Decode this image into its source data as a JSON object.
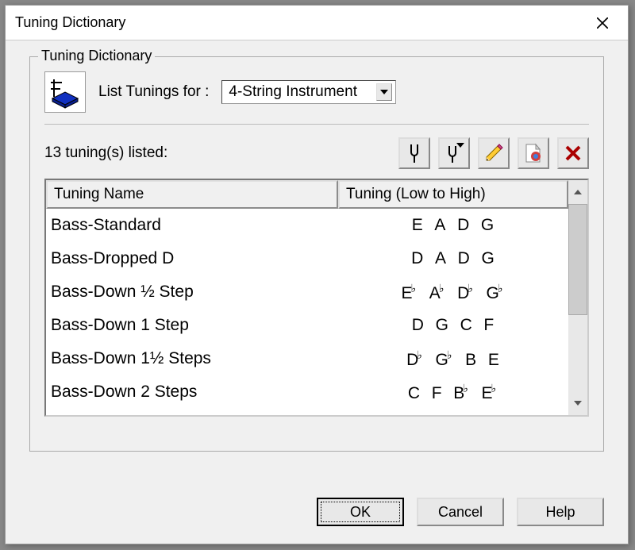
{
  "window": {
    "title": "Tuning Dictionary"
  },
  "group": {
    "title": "Tuning Dictionary",
    "list_label": "List Tunings for :",
    "dropdown_value": "4-String Instrument",
    "listed_text": "13 tuning(s) listed:"
  },
  "headers": {
    "name": "Tuning Name",
    "tuning": "Tuning (Low to High)"
  },
  "rows": [
    {
      "name": "Bass-Standard",
      "tuning": "E A D G"
    },
    {
      "name": "Bass-Dropped D",
      "tuning": "D A D G"
    },
    {
      "name": "Bass-Down ½ Step",
      "tuning": "E♭ A♭ D♭ G♭"
    },
    {
      "name": "Bass-Down 1 Step",
      "tuning": "D G C F"
    },
    {
      "name": "Bass-Down 1½ Steps",
      "tuning": "D♭ G♭ B E"
    },
    {
      "name": "Bass-Down 2 Steps",
      "tuning": "C F B♭ E♭"
    }
  ],
  "buttons": {
    "ok": "OK",
    "cancel": "Cancel",
    "help": "Help"
  },
  "toolbar_icons": {
    "fork": "tuning-fork-icon",
    "fork_arrow": "tuning-fork-arrow-icon",
    "edit": "pencil-icon",
    "new": "new-doc-icon",
    "delete": "delete-icon"
  }
}
